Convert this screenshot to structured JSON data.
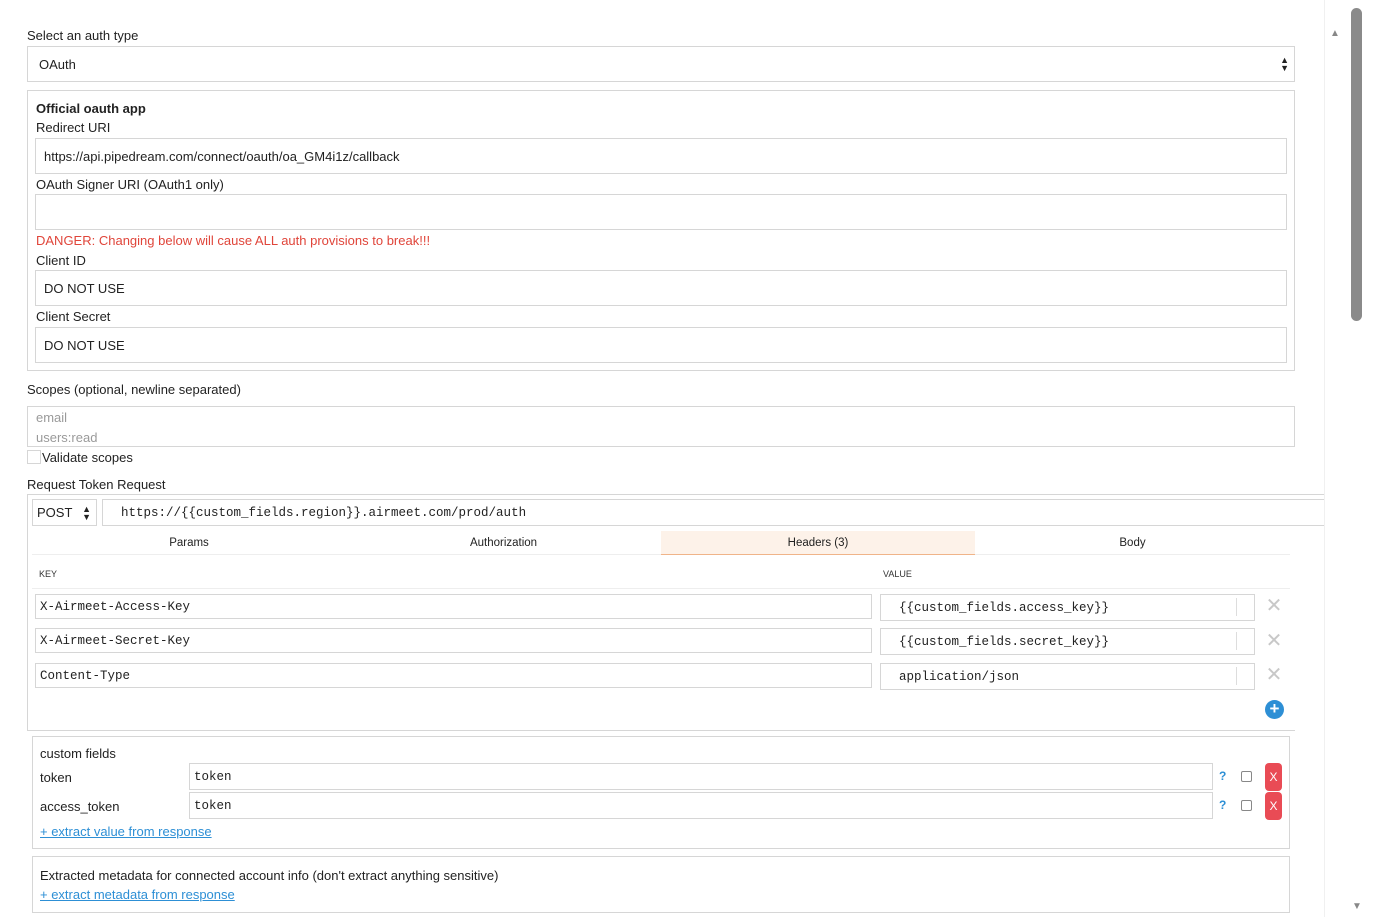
{
  "auth_type": {
    "label": "Select an auth type",
    "value": "OAuth"
  },
  "oauth_app": {
    "title": "Official oauth app",
    "redirect_label": "Redirect URI",
    "redirect_value": "https://api.pipedream.com/connect/oauth/oa_GM4i1z/callback",
    "signer_label": "OAuth Signer URI (OAuth1 only)",
    "signer_value": "",
    "danger_text": "DANGER: Changing below will cause ALL auth provisions to break!!!",
    "client_id_label": "Client ID",
    "client_id_value": "DO NOT USE",
    "client_secret_label": "Client Secret",
    "client_secret_value": "DO NOT USE"
  },
  "scopes": {
    "label": "Scopes (optional, newline separated)",
    "placeholder_lines": [
      "email",
      "users:read"
    ],
    "validate_label": "Validate scopes"
  },
  "token_request": {
    "label": "Request Token Request",
    "method": "POST",
    "url": "https://{{custom_fields.region}}.airmeet.com/prod/auth",
    "tabs": [
      "Params",
      "Authorization",
      "Headers (3)",
      "Body"
    ],
    "active_tab": "Headers (3)",
    "key_header": "KEY",
    "value_header": "VALUE",
    "headers": [
      {
        "key": "X-Airmeet-Access-Key",
        "value": "{{custom_fields.access_key}}"
      },
      {
        "key": "X-Airmeet-Secret-Key",
        "value": "{{custom_fields.secret_key}}"
      },
      {
        "key": "Content-Type",
        "value": "application/json"
      }
    ],
    "add_icon": "plus-circle-icon",
    "remove_icon": "close-icon"
  },
  "custom_fields": {
    "title": "custom fields",
    "rows": [
      {
        "name": "token",
        "value": "token",
        "help": "?",
        "remove": "X"
      },
      {
        "name": "access_token",
        "value": "token",
        "help": "?",
        "remove": "X"
      }
    ],
    "extract_link": "+ extract value from response"
  },
  "metadata": {
    "title": "Extracted metadata for connected account info (don't extract anything sensitive)",
    "extract_link": "+ extract metadata from response"
  },
  "colors": {
    "danger": "#e0453a",
    "link": "#2d8fd5",
    "remove_button": "#e94b55",
    "active_tab": "#fdf2e9"
  }
}
